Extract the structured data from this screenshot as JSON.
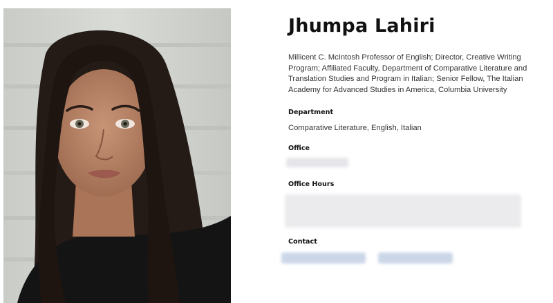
{
  "profile": {
    "name": "Jhumpa Lahiri",
    "title": "Millicent C. McIntosh Professor of English; Director, Creative Writing Program; Affiliated Faculty, Department of Comparative Literature and Translation Studies and Program in Italian; Senior Fellow, The Italian Academy for Advanced Studies in America, Columbia University"
  },
  "details": {
    "department_label": "Department",
    "department_value": "Comparative Literature, English, Italian",
    "office_label": "Office",
    "office_hours_label": "Office Hours",
    "contact_label": "Contact"
  },
  "colors": {
    "redacted_gray": "#e6e6ea",
    "redacted_blue": "#cbd7e8"
  }
}
